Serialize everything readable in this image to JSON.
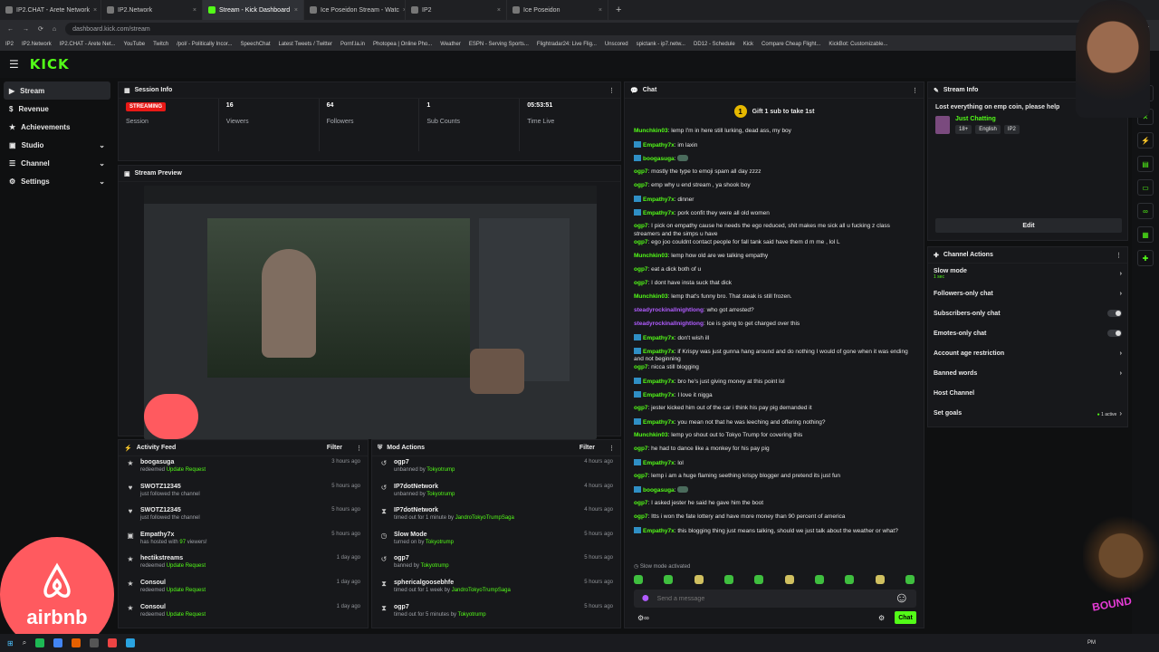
{
  "browser": {
    "tabs": [
      {
        "label": "IP2.CHAT - Arete Network",
        "active": false
      },
      {
        "label": "IP2.Network",
        "active": false
      },
      {
        "label": "Stream - Kick Dashboard",
        "active": true
      },
      {
        "label": "Ice Poseidon Stream - Watc",
        "active": false
      },
      {
        "label": "IP2",
        "active": false
      },
      {
        "label": "Ice Poseidon",
        "active": false
      }
    ],
    "url": "dashboard.kick.com/stream",
    "bookmarks": [
      "IP2",
      "IP2.Network",
      "IP2.CHAT - Arete Net...",
      "YouTube",
      "Twitch",
      "/pol/ - Politically Incor...",
      "SpeechChat",
      "Latest Tweets / Twitter",
      "Pornf.la.in",
      "Photopea | Online Pho...",
      "Weather",
      "ESPN - Serving Sports...",
      "Flightradar24: Live Flig...",
      "Unscored",
      "spictank - ip7.netw...",
      "DD12 - Schedule",
      "Kick",
      "Compare Cheap Flight...",
      "KickBot: Customizable..."
    ]
  },
  "app": {
    "logo": "KICK",
    "sidebar": [
      {
        "label": "Stream",
        "active": true,
        "chevron": false
      },
      {
        "label": "Revenue",
        "active": false,
        "chevron": false
      },
      {
        "label": "Achievements",
        "active": false,
        "chevron": false
      },
      {
        "label": "Studio",
        "active": false,
        "chevron": true
      },
      {
        "label": "Channel",
        "active": false,
        "chevron": true
      },
      {
        "label": "Settings",
        "active": false,
        "chevron": true
      }
    ]
  },
  "session": {
    "title": "Session Info",
    "status": "STREAMING",
    "status_label": "Session",
    "stats": [
      {
        "value": "16",
        "label": "Viewers"
      },
      {
        "value": "64",
        "label": "Followers"
      },
      {
        "value": "1",
        "label": "Sub Counts"
      },
      {
        "value": "05:53:51",
        "label": "Time Live"
      }
    ]
  },
  "preview": {
    "title": "Stream Preview"
  },
  "activity": {
    "title": "Activity Feed",
    "filter": "Filter",
    "items": [
      {
        "icon": "★",
        "user": "boogasuga",
        "pre": "redeemed ",
        "hl": "Update Request",
        "post": "",
        "time": "3 hours ago"
      },
      {
        "icon": "♥",
        "user": "SWOTZ12345",
        "pre": "just followed the channel",
        "hl": "",
        "post": "",
        "time": "5 hours ago"
      },
      {
        "icon": "♥",
        "user": "SWOTZ12345",
        "pre": "just followed the channel",
        "hl": "",
        "post": "",
        "time": "5 hours ago"
      },
      {
        "icon": "▣",
        "user": "Empathy7x",
        "pre": "has hosted with ",
        "hl": "97",
        "post": " viewers!",
        "time": "5 hours ago"
      },
      {
        "icon": "★",
        "user": "hectikstreams",
        "pre": "redeemed ",
        "hl": "Update Request",
        "post": "",
        "time": "1 day ago"
      },
      {
        "icon": "★",
        "user": "Consoul",
        "pre": "redeemed ",
        "hl": "Update Request",
        "post": "",
        "time": "1 day ago"
      },
      {
        "icon": "★",
        "user": "Consoul",
        "pre": "redeemed ",
        "hl": "Update Request",
        "post": "",
        "time": "1 day ago"
      }
    ]
  },
  "mod": {
    "title": "Mod Actions",
    "filter": "Filter",
    "items": [
      {
        "icon": "↺",
        "user": "ogp7",
        "pre": "unbanned by ",
        "hl": "Tokyotrump",
        "time": "4 hours ago"
      },
      {
        "icon": "↺",
        "user": "IP7dotNetwork",
        "pre": "unbanned by ",
        "hl": "Tokyotrump",
        "time": "4 hours ago"
      },
      {
        "icon": "⧗",
        "user": "IP7dotNetwork",
        "pre": "timed out for 1 minute by ",
        "hl": "JandroTokyoTrumpSaga",
        "time": "4 hours ago"
      },
      {
        "icon": "◷",
        "user": "Slow Mode",
        "pre": "turned on by ",
        "hl": "Tokyotrump",
        "time": "5 hours ago"
      },
      {
        "icon": "↺",
        "user": "ogp7",
        "pre": "banned by ",
        "hl": "Tokyotrump",
        "time": "5 hours ago"
      },
      {
        "icon": "⧗",
        "user": "sphericalgoosebhfe",
        "pre": "timed out for 1 week by ",
        "hl": "JandroTokyoTrumpSaga",
        "time": "5 hours ago"
      },
      {
        "icon": "⧗",
        "user": "ogp7",
        "pre": "timed out for 5 minutes by ",
        "hl": "Tokyotrump",
        "time": "5 hours ago"
      }
    ]
  },
  "chat": {
    "title": "Chat",
    "gift": "Gift 1 sub to take 1st",
    "messages": [
      {
        "user": "Munchkin03",
        "color": "#53fc18",
        "badge": false,
        "text": "lemp I'm in here still lurking, dead ass, my boy"
      },
      {
        "user": "Empathy7x",
        "color": "#53fc18",
        "badge": true,
        "text": "im laxin"
      },
      {
        "user": "boogasuga",
        "color": "#53fc18",
        "badge": true,
        "text": ""
      },
      {
        "user": "ogp7",
        "color": "#53fc18",
        "badge": false,
        "text": "mostly the type to emoji spam all day zzzz"
      },
      {
        "user": "ogp7",
        "color": "#53fc18",
        "badge": false,
        "text": "emp why u end stream , ya shook boy"
      },
      {
        "user": "Empathy7x",
        "color": "#53fc18",
        "badge": true,
        "text": "dinner"
      },
      {
        "user": "Empathy7x",
        "color": "#53fc18",
        "badge": true,
        "text": "pork confit they were all old women"
      },
      {
        "user": "ogp7",
        "color": "#53fc18",
        "badge": false,
        "text": "I pick on empathy cause he needs the ego reduced, shit makes me sick all u fucking z class streamers and the simps u have"
      },
      {
        "user": "ogp7",
        "color": "#53fc18",
        "badge": false,
        "text": "ego joo couldnt contact people for fall tank said have them d m me , lol L"
      },
      {
        "user": "Munchkin03",
        "color": "#53fc18",
        "badge": false,
        "text": "lemp how old are we talking empathy"
      },
      {
        "user": "ogp7",
        "color": "#53fc18",
        "badge": false,
        "text": "eat a dick both of u"
      },
      {
        "user": "ogp7",
        "color": "#53fc18",
        "badge": false,
        "text": "I dont have insta suck that dick"
      },
      {
        "user": "Munchkin03",
        "color": "#53fc18",
        "badge": false,
        "text": "lemp that's funny bro. That steak is still frozen."
      },
      {
        "user": "steadyrockinallnightlong",
        "color": "#b15cff",
        "badge": false,
        "text": "who got arrested?"
      },
      {
        "user": "steadyrockinallnightlong",
        "color": "#b15cff",
        "badge": false,
        "text": "Ice is going to get charged over this"
      },
      {
        "user": "Empathy7x",
        "color": "#53fc18",
        "badge": true,
        "text": "don't wish ill"
      },
      {
        "user": "Empathy7x",
        "color": "#53fc18",
        "badge": true,
        "text": "if Krispy was just gunna hang around and do nothing I would of gone when it was ending and not beginning"
      },
      {
        "user": "ogp7",
        "color": "#53fc18",
        "badge": false,
        "text": "nicca still blogging"
      },
      {
        "user": "Empathy7x",
        "color": "#53fc18",
        "badge": true,
        "text": "bro he's just giving money at this point lol"
      },
      {
        "user": "Empathy7x",
        "color": "#53fc18",
        "badge": true,
        "text": "I love it nigga"
      },
      {
        "user": "ogp7",
        "color": "#53fc18",
        "badge": false,
        "text": "jester kicked him out of the car i think his pay pig demanded it"
      },
      {
        "user": "Empathy7x",
        "color": "#53fc18",
        "badge": true,
        "text": "you mean not that he was leeching and offering nothing?"
      },
      {
        "user": "Munchkin03",
        "color": "#53fc18",
        "badge": false,
        "text": "lemp yo shout out to Tokyo Trump for covering this"
      },
      {
        "user": "ogp7",
        "color": "#53fc18",
        "badge": false,
        "text": "he had to dance like a monkey for his pay pig"
      },
      {
        "user": "Empathy7x",
        "color": "#53fc18",
        "badge": true,
        "text": "lol"
      },
      {
        "user": "ogp7",
        "color": "#53fc18",
        "badge": false,
        "text": "lemp i am a huge flaming seething krispy blogger and pretend its just fun"
      },
      {
        "user": "boogasuga",
        "color": "#53fc18",
        "badge": true,
        "text": ""
      },
      {
        "user": "ogp7",
        "color": "#53fc18",
        "badge": false,
        "text": "I asked jester he said he gave him the boot"
      },
      {
        "user": "ogp7",
        "color": "#53fc18",
        "badge": false,
        "text": "Itts i won the fate lottery and have more money than 90 percent of america"
      },
      {
        "user": "Empathy7x",
        "color": "#53fc18",
        "badge": true,
        "text": "this blogging thing just means talking, should we just talk about the weather or what?"
      }
    ],
    "slow_mode": "Slow mode activated",
    "placeholder": "Send a message",
    "send": "Chat"
  },
  "stream_info": {
    "title": "Stream Info",
    "stream_title": "Lost everything on emp coin, please help",
    "category": "Just Chatting",
    "tags": [
      "18+",
      "English",
      "IP2"
    ],
    "edit": "Edit"
  },
  "channel_actions": {
    "title": "Channel Actions",
    "items": [
      {
        "label": "Slow mode",
        "sub": "1 sec",
        "control": "chevron"
      },
      {
        "label": "Followers-only chat",
        "sub": "",
        "control": "chevron"
      },
      {
        "label": "Subscribers-only chat",
        "sub": "",
        "control": "toggle"
      },
      {
        "label": "Emotes-only chat",
        "sub": "",
        "control": "toggle"
      },
      {
        "label": "Account age restriction",
        "sub": "",
        "control": "chevron"
      },
      {
        "label": "Banned words",
        "sub": "",
        "control": "chevron"
      },
      {
        "label": "Host Channel",
        "sub": "",
        "control": "none"
      },
      {
        "label": "Set goals",
        "sub": "",
        "control": "active",
        "active_text": "1 active"
      }
    ]
  },
  "overlays": {
    "airbnb": "airbnb",
    "chewie_text": "BOUND"
  },
  "taskbar": {
    "clock": "PM"
  }
}
